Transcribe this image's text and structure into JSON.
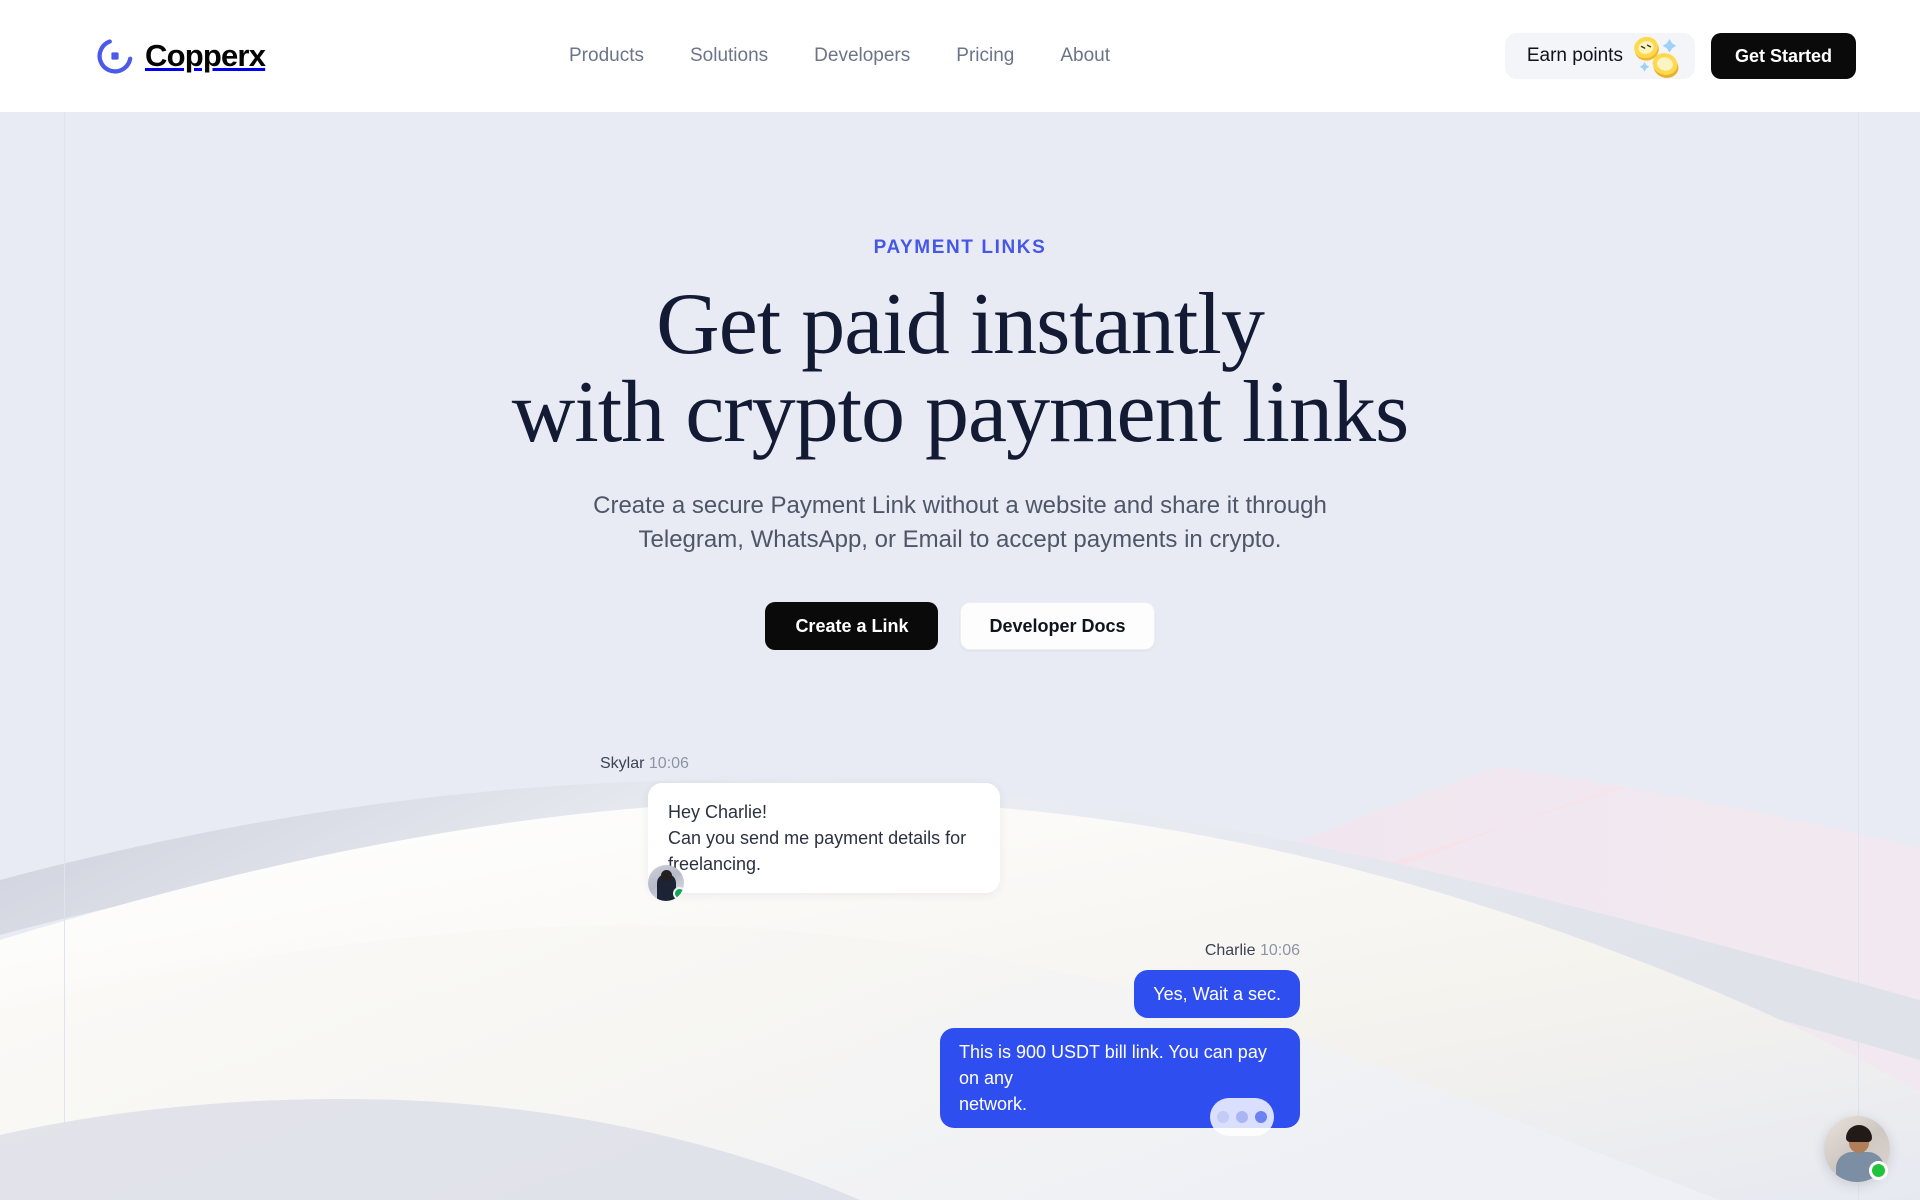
{
  "brand": {
    "name": "Copperx",
    "logo_icon": "copperx-circle-logo-icon",
    "accent": "#4657e6"
  },
  "header": {
    "nav": [
      {
        "label": "Products"
      },
      {
        "label": "Solutions"
      },
      {
        "label": "Developers"
      },
      {
        "label": "Pricing"
      },
      {
        "label": "About"
      }
    ],
    "earn_points_label": "Earn points",
    "earn_points_icon": "gold-coins-icon",
    "get_started_label": "Get Started"
  },
  "hero": {
    "eyebrow": "PAYMENT LINKS",
    "headline_line1": "Get paid instantly",
    "headline_line2": "with crypto payment links",
    "subhead_line1": "Create a secure Payment Link without a website and share it through",
    "subhead_line2": "Telegram, WhatsApp, or Email to accept payments in crypto.",
    "primary_cta": "Create a Link",
    "secondary_cta": "Developer Docs"
  },
  "chat": {
    "incoming": {
      "sender": "Skylar",
      "time": "10:06",
      "avatar_icon": "skylar-avatar",
      "status_icon": "online-dot-icon",
      "lines": [
        "Hey Charlie!",
        "Can you send me payment details for",
        "freelancing."
      ]
    },
    "outgoing": {
      "sender": "Charlie",
      "time": "10:06",
      "bubble1": "Yes, Wait a sec.",
      "bubble2_line1": "This is 900 USDT bill link. You can pay on any",
      "bubble2_line2": "network.",
      "bubble_color": "#2f4ef0"
    },
    "typing_indicator": "typing-dots-icon"
  },
  "support": {
    "avatar_icon": "support-agent-avatar",
    "status_icon": "online-dot-icon"
  }
}
